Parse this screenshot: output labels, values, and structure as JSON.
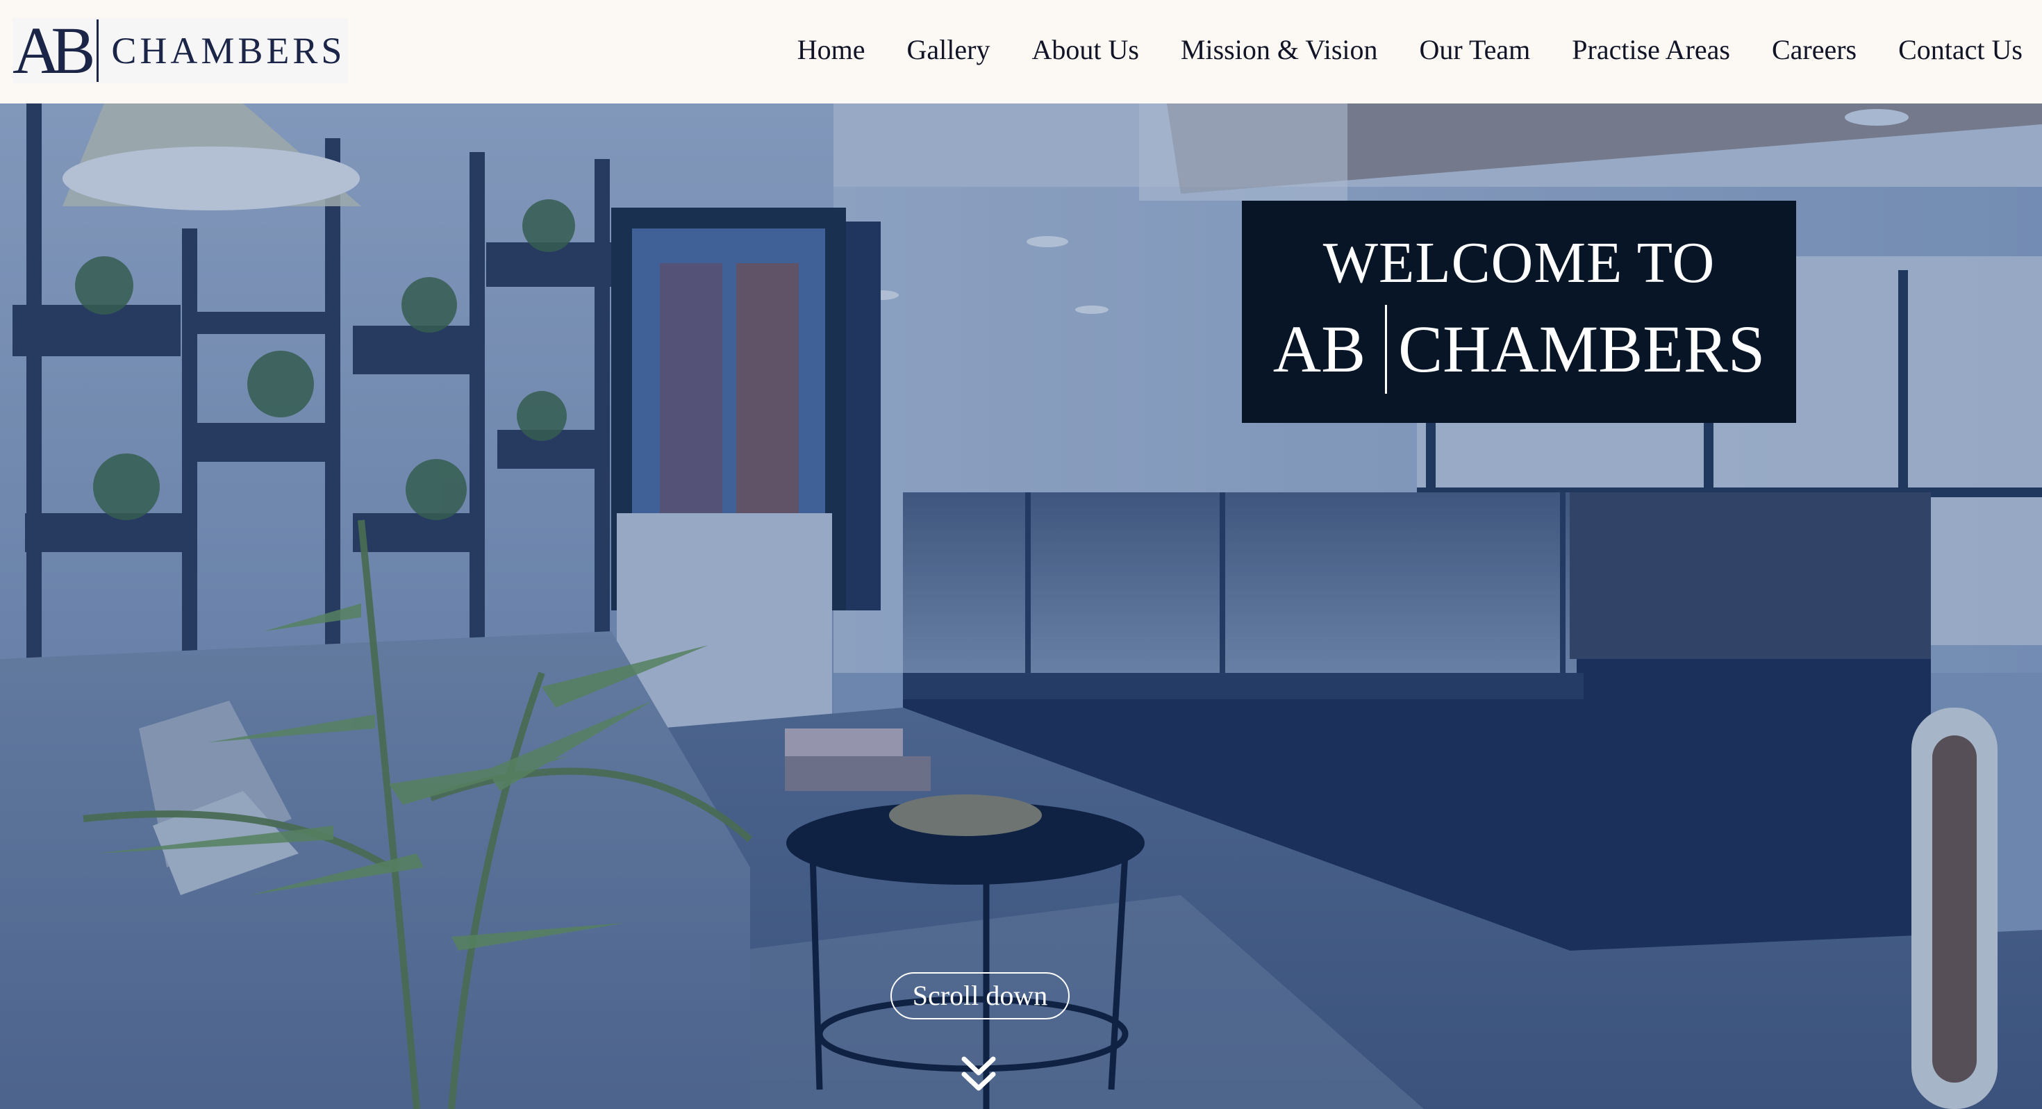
{
  "header": {
    "logo": {
      "mark": "AB",
      "text": "CHAMBERS"
    },
    "nav": [
      {
        "label": "Home"
      },
      {
        "label": "Gallery"
      },
      {
        "label": "About Us"
      },
      {
        "label": "Mission & Vision"
      },
      {
        "label": "Our Team"
      },
      {
        "label": "Practise Areas"
      },
      {
        "label": "Careers"
      },
      {
        "label": "Contact Us"
      }
    ]
  },
  "hero": {
    "welcome_line1": "WELCOME TO",
    "welcome_brand_left": "AB",
    "welcome_brand_right": "CHAMBERS",
    "scroll_label": "Scroll down",
    "scroll_icon": "double-chevron-down-icon"
  },
  "colors": {
    "header_bg": "#fcf8f3",
    "brand_navy": "#1b2547",
    "welcome_bg": "#071526",
    "hero_tint": "#3f5b86"
  }
}
